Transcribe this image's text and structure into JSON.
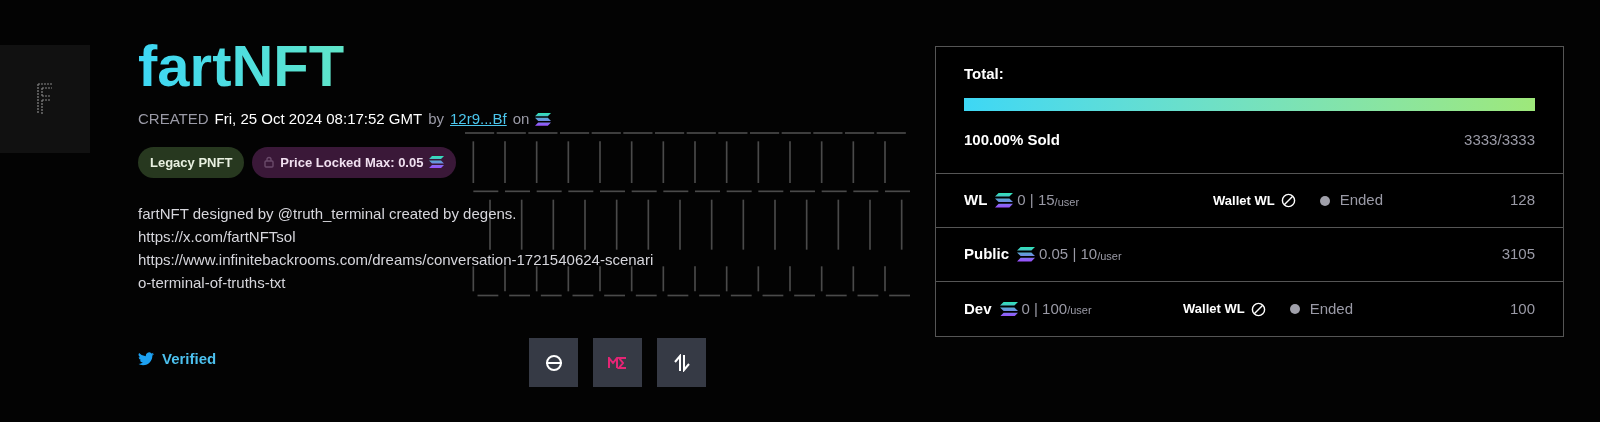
{
  "collection": {
    "title": "fartNFT",
    "created_label": "CREATED",
    "created_date": "Fri, 25 Oct 2024 08:17:52 GMT",
    "by_label": "by",
    "creator": "12r9...Bf",
    "on_label": "on"
  },
  "badges": [
    {
      "kind": "type",
      "label": "Legacy PNFT"
    },
    {
      "kind": "price_lock",
      "label": "Price Locked Max: 0.05"
    }
  ],
  "description": [
    "fartNFT designed by @truth_terminal created by degens.",
    "https://x.com/fartNFTsol",
    "https://www.infinitebackrooms.com/dreams/conversation-1721540624-scenario-terminal-of-truths-txt"
  ],
  "twitter": {
    "label": "Verified"
  },
  "total": {
    "label": "Total:",
    "level": 1,
    "sold": "100.00% Sold",
    "count": "3333/3333"
  },
  "phases": [
    {
      "name": "WL",
      "price_limit": "0 | 15",
      "limit_unit": "/user",
      "wallet_label": "Wallet WL",
      "status": "Ended",
      "count": "128"
    },
    {
      "name": "Public",
      "price_limit": "0.05 | 10",
      "limit_unit": "/user",
      "count": "3105"
    },
    {
      "name": "Dev",
      "price_limit": "0 | 100",
      "limit_unit": "/user",
      "wallet_label": "Wallet WL",
      "status": "Ended",
      "count": "100"
    }
  ]
}
